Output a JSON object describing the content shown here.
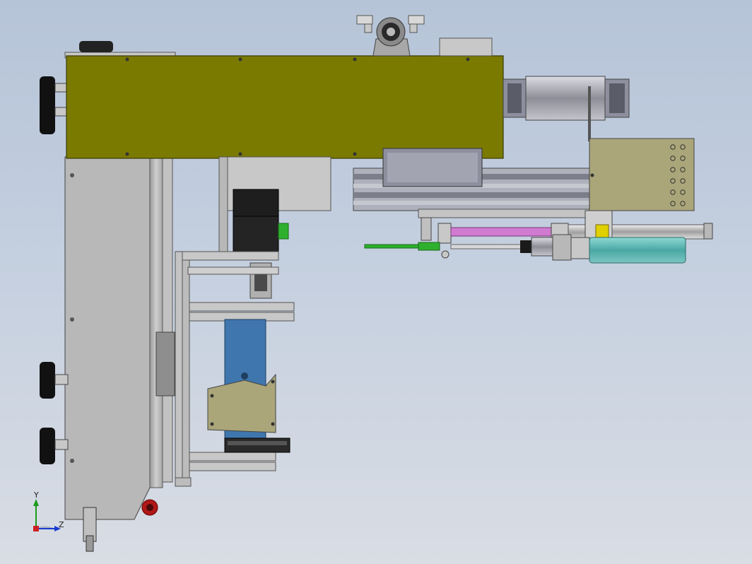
{
  "triad": {
    "y_label": "Y",
    "z_label": "Z"
  },
  "colors": {
    "background_top": "#b6c4d8",
    "background_bottom": "#d9dde4",
    "olive_housing": "#7a7a00",
    "steel": "#b4b4b4",
    "blue_block": "#3f76ad",
    "khaki_plate": "#aaa67a",
    "cyan_motor": "#59b8b4",
    "magenta_rod": "#d07ad0",
    "green_nozzle": "#2eb02e",
    "yellow_collar": "#e0d000",
    "knob_black": "#111111",
    "red_plug": "#b01818"
  }
}
